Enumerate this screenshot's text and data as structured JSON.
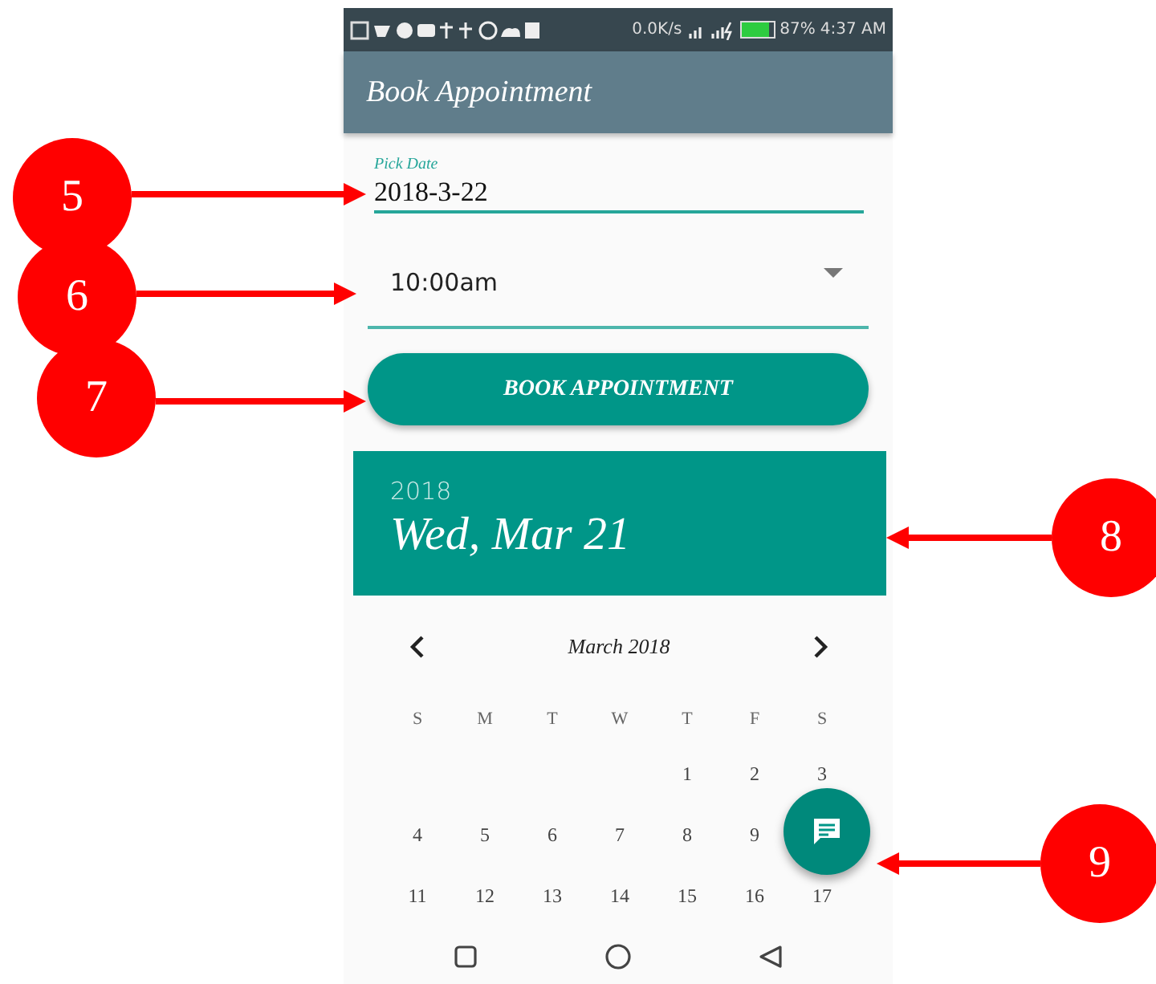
{
  "status_bar": {
    "speed": "0.0K/s",
    "battery": "87%",
    "time": "4:37 AM"
  },
  "app_bar": {
    "title": "Book Appointment"
  },
  "date_field": {
    "label": "Pick Date",
    "value": "2018-3-22"
  },
  "time_select": {
    "value": "10:00am"
  },
  "book_button": {
    "label": "BOOK APPOINTMENT"
  },
  "date_picker": {
    "year": "2018",
    "date": "Wed, Mar 21",
    "month": "March 2018",
    "weekdays": [
      "S",
      "M",
      "T",
      "W",
      "T",
      "F",
      "S"
    ],
    "weeks": [
      [
        "1",
        "2",
        "3"
      ],
      [
        "4",
        "5",
        "6",
        "7",
        "8",
        "9"
      ],
      [
        "11",
        "12",
        "13",
        "14",
        "15",
        "16",
        "17"
      ]
    ]
  },
  "callouts": [
    {
      "label": "5"
    },
    {
      "label": "6"
    },
    {
      "label": "7"
    },
    {
      "label": "8"
    },
    {
      "label": "9"
    }
  ]
}
